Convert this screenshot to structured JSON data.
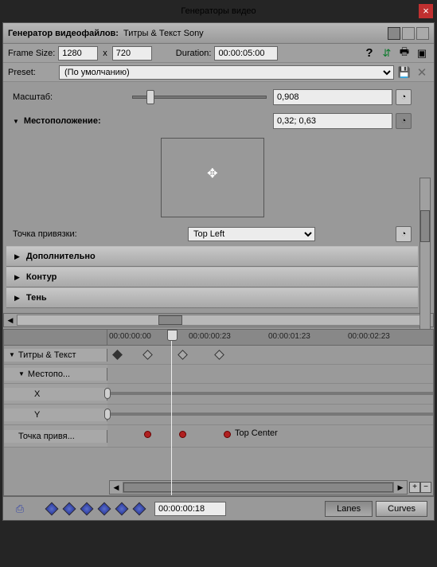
{
  "title": "Генераторы видео",
  "header": {
    "label": "Генератор видеофайлов:",
    "value": "Титры & Текст Sony"
  },
  "frame": {
    "size_label": "Frame Size:",
    "width": "1280",
    "x": "x",
    "height": "720",
    "duration_label": "Duration:",
    "duration": "00:00:05:00"
  },
  "preset": {
    "label": "Preset:",
    "value": "(По умолчанию)"
  },
  "props": {
    "scale_label": "Масштаб:",
    "scale_value": "0,908",
    "position_label": "Местоположение:",
    "position_value": "0,32; 0,63",
    "anchor_label": "Точка привязки:",
    "anchor_value": "Top Left"
  },
  "sections": {
    "advanced": "Дополнительно",
    "outline": "Контур",
    "shadow": "Тень"
  },
  "timeline": {
    "ticks": [
      "00:00:00:00",
      "00:00:00:23",
      "00:00:01:23",
      "00:00:02:23"
    ],
    "track_main": "Титры & Текст",
    "track_pos": "Местопо...",
    "track_x": "X",
    "track_y": "Y",
    "track_anchor": "Точка привя...",
    "anchor_kf_label": "Top Center"
  },
  "footer": {
    "timecode": "00:00:00:18",
    "lanes": "Lanes",
    "curves": "Curves"
  }
}
